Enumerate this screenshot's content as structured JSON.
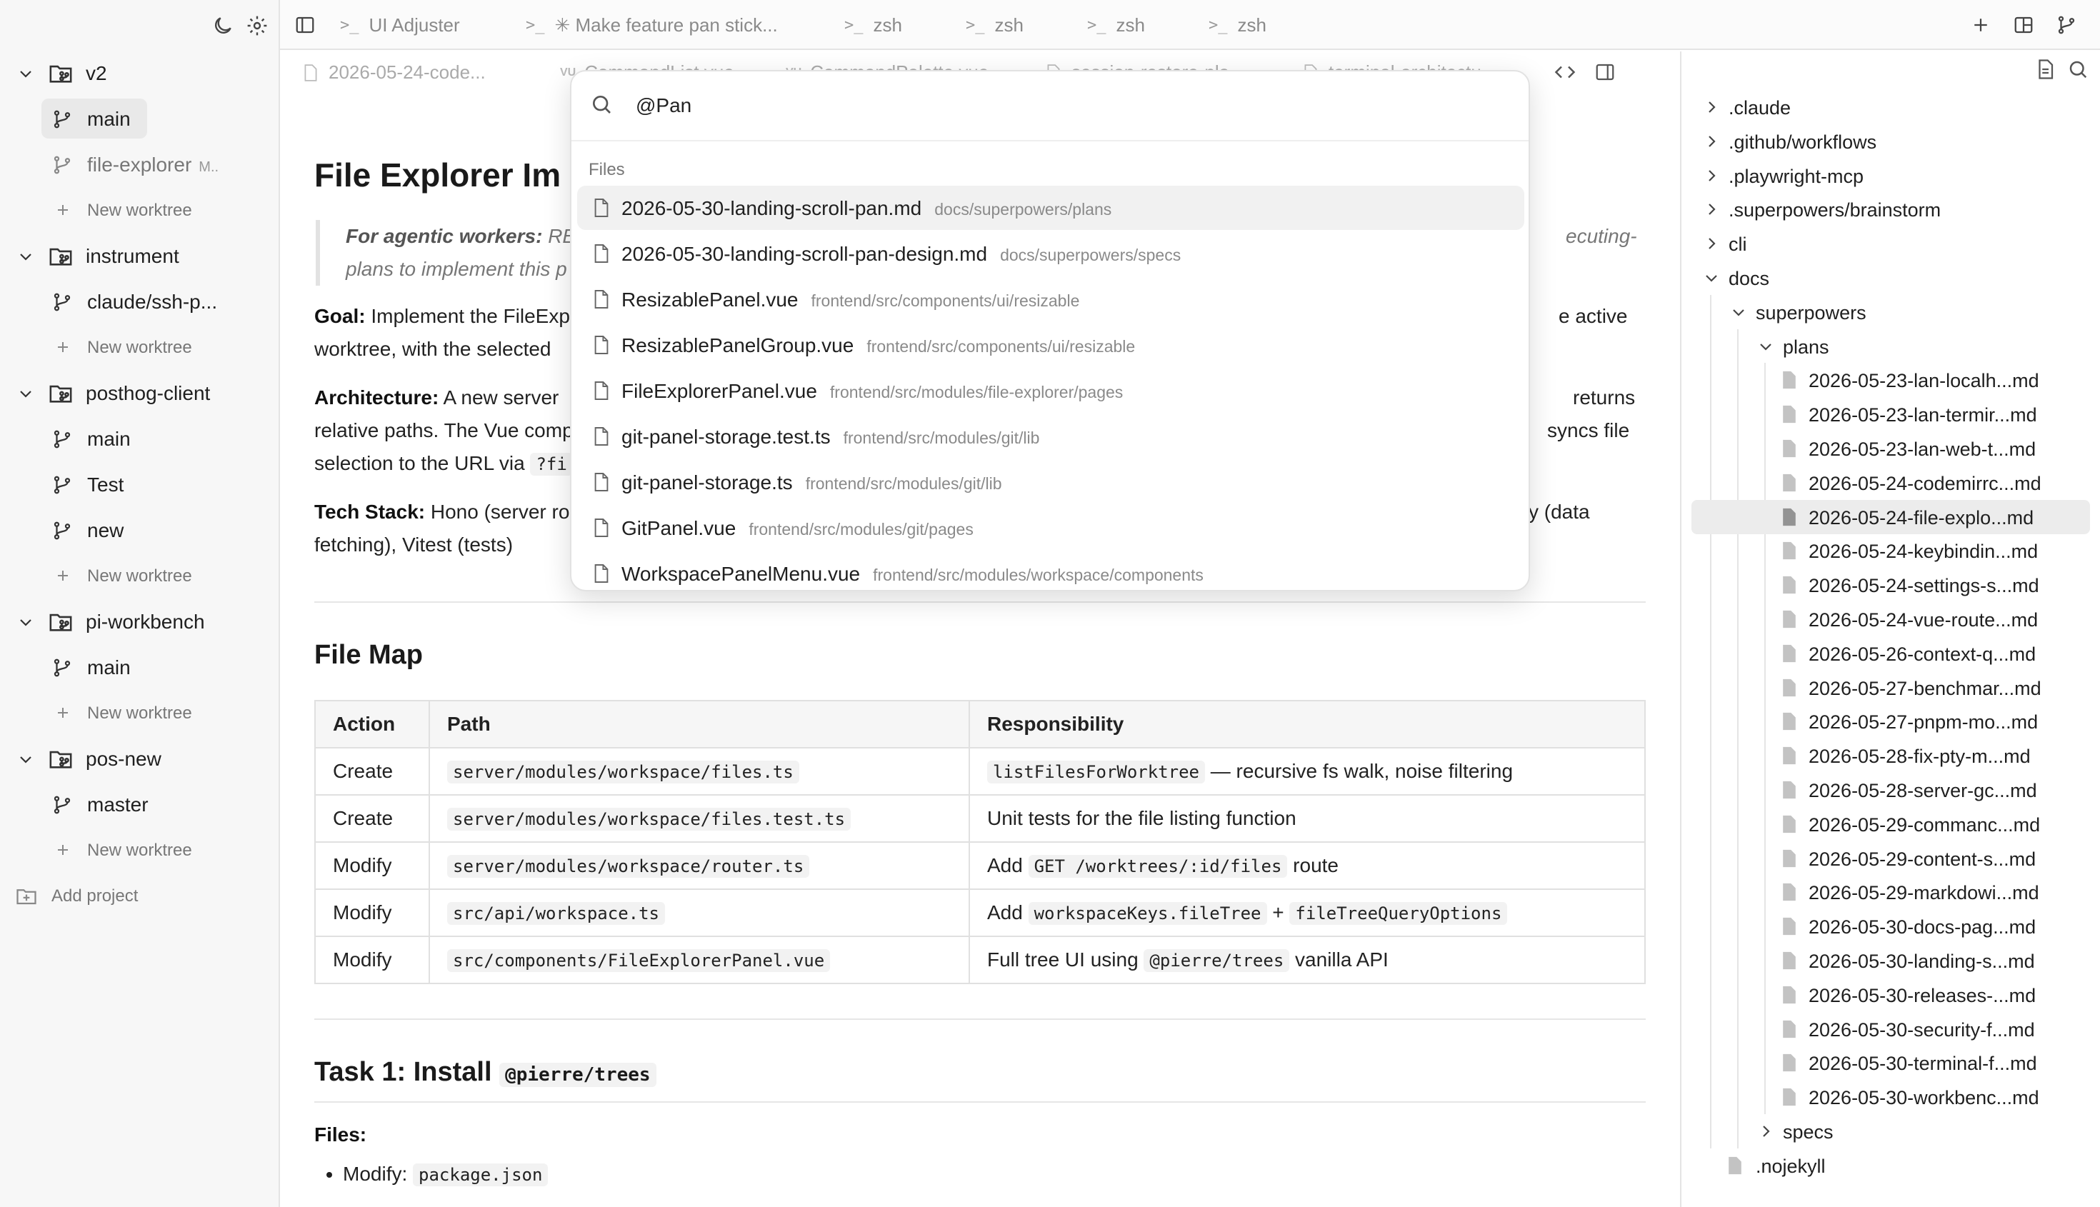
{
  "sidebar": {
    "projects": [
      {
        "name": "v2",
        "worktrees": [
          {
            "name": "main",
            "active": true
          },
          {
            "name": "file-explorer",
            "suffix": "M..",
            "dim": true
          }
        ]
      },
      {
        "name": "instrument",
        "worktrees": [
          {
            "name": "claude/ssh-p..."
          }
        ]
      },
      {
        "name": "posthog-client",
        "worktrees": [
          {
            "name": "main"
          },
          {
            "name": "Test"
          },
          {
            "name": "new"
          }
        ]
      },
      {
        "name": "pi-workbench",
        "worktrees": [
          {
            "name": "main"
          }
        ]
      },
      {
        "name": "pos-new",
        "worktrees": [
          {
            "name": "master"
          }
        ]
      }
    ],
    "new_worktree_label": "New worktree",
    "add_project_label": "Add project",
    "icons": [
      "moon-icon",
      "gear-icon"
    ]
  },
  "tabbar": {
    "tabs": [
      {
        "label": "UI Adjuster"
      },
      {
        "label": "✳ Make feature pan stick..."
      },
      {
        "label": "zsh"
      },
      {
        "label": "zsh"
      },
      {
        "label": "zsh"
      },
      {
        "label": "zsh"
      }
    ],
    "icons": [
      "sidebar-toggle-icon",
      "plus-icon",
      "split-panel-icon",
      "branch-icon"
    ]
  },
  "editor_tabs": [
    {
      "label": "2026-05-24-code..."
    },
    {
      "label": "CommandList.vue"
    },
    {
      "label": "CommandPalette.vue"
    },
    {
      "label": "session-restore-pla..."
    },
    {
      "label": "terminal-architectu..."
    }
  ],
  "document": {
    "title": "File Explorer Im",
    "quote_lead": "For agentic workers:",
    "quote_line1": "RE",
    "quote_line1_right": "ecuting-",
    "quote_line2": "plans to implement this p",
    "goal_label": "Goal:",
    "goal_text_left": "Implement the FileExp",
    "goal_text_right": "e active",
    "goal_line2": "worktree, with the selected",
    "arch_label": "Architecture:",
    "arch_text_left": "A new server",
    "arch_text_right": "returns",
    "arch_line2_left": "relative paths. The Vue comp",
    "arch_line2_right": "syncs file",
    "arch_line3": "selection to the URL via",
    "arch_line3_code": "?fi",
    "tech_label": "Tech Stack:",
    "tech_text_left": "Hono (server ro",
    "tech_text_right": "y (data",
    "tech_line2": "fetching), Vitest (tests)",
    "filemap_heading": "File Map",
    "table": {
      "headers": [
        "Action",
        "Path",
        "Responsibility"
      ],
      "rows": [
        {
          "action": "Create",
          "path": "server/modules/workspace/files.ts",
          "resp_code": "listFilesForWorktree",
          "resp_text": "— recursive fs walk, noise filtering"
        },
        {
          "action": "Create",
          "path": "server/modules/workspace/files.test.ts",
          "resp_text": "Unit tests for the file listing function"
        },
        {
          "action": "Modify",
          "path": "server/modules/workspace/router.ts",
          "resp_pre": "Add",
          "resp_code": "GET /worktrees/:id/files",
          "resp_text": "route"
        },
        {
          "action": "Modify",
          "path": "src/api/workspace.ts",
          "resp_pre": "Add",
          "resp_code": "workspaceKeys.fileTree",
          "resp_mid": "+",
          "resp_code2": "fileTreeQueryOptions"
        },
        {
          "action": "Modify",
          "path": "src/components/FileExplorerPanel.vue",
          "resp_pre": "Full tree UI using",
          "resp_code": "@pierre/trees",
          "resp_text": "vanilla API"
        }
      ]
    },
    "task1_heading": "Task 1: Install",
    "task1_code": "@pierre/trees",
    "files_label": "Files:",
    "files_item_pre": "Modify:",
    "files_item_code": "package.json"
  },
  "palette": {
    "query": "@Pan",
    "group_label": "Files",
    "items": [
      {
        "name": "2026-05-30-landing-scroll-pan.md",
        "path": "docs/superpowers/plans",
        "selected": true
      },
      {
        "name": "2026-05-30-landing-scroll-pan-design.md",
        "path": "docs/superpowers/specs"
      },
      {
        "name": "ResizablePanel.vue",
        "path": "frontend/src/components/ui/resizable"
      },
      {
        "name": "ResizablePanelGroup.vue",
        "path": "frontend/src/components/ui/resizable"
      },
      {
        "name": "FileExplorerPanel.vue",
        "path": "frontend/src/modules/file-explorer/pages"
      },
      {
        "name": "git-panel-storage.test.ts",
        "path": "frontend/src/modules/git/lib"
      },
      {
        "name": "git-panel-storage.ts",
        "path": "frontend/src/modules/git/lib"
      },
      {
        "name": "GitPanel.vue",
        "path": "frontend/src/modules/git/pages"
      },
      {
        "name": "WorkspacePanelMenu.vue",
        "path": "frontend/src/modules/workspace/components"
      }
    ]
  },
  "file_tree": {
    "top_folders": [
      ".claude",
      ".github/workflows",
      ".playwright-mcp",
      ".superpowers/brainstorm",
      "cli"
    ],
    "docs": "docs",
    "superpowers": "superpowers",
    "plans": "plans",
    "plan_files": [
      "2026-05-23-lan-localh...md",
      "2026-05-23-lan-termir...md",
      "2026-05-23-lan-web-t...md",
      "2026-05-24-codemirrc...md",
      "2026-05-24-file-explo...md",
      "2026-05-24-keybindin...md",
      "2026-05-24-settings-s...md",
      "2026-05-24-vue-route...md",
      "2026-05-26-context-q...md",
      "2026-05-27-benchmar...md",
      "2026-05-27-pnpm-mo...md",
      "2026-05-28-fix-pty-m...md",
      "2026-05-28-server-gc...md",
      "2026-05-29-commanc...md",
      "2026-05-29-content-s...md",
      "2026-05-29-markdowi...md",
      "2026-05-30-docs-pag...md",
      "2026-05-30-landing-s...md",
      "2026-05-30-releases-...md",
      "2026-05-30-security-f...md",
      "2026-05-30-terminal-f...md",
      "2026-05-30-workbenc...md"
    ],
    "selected_index": 4,
    "specs": "specs",
    "nojekyll": ".nojekyll"
  }
}
